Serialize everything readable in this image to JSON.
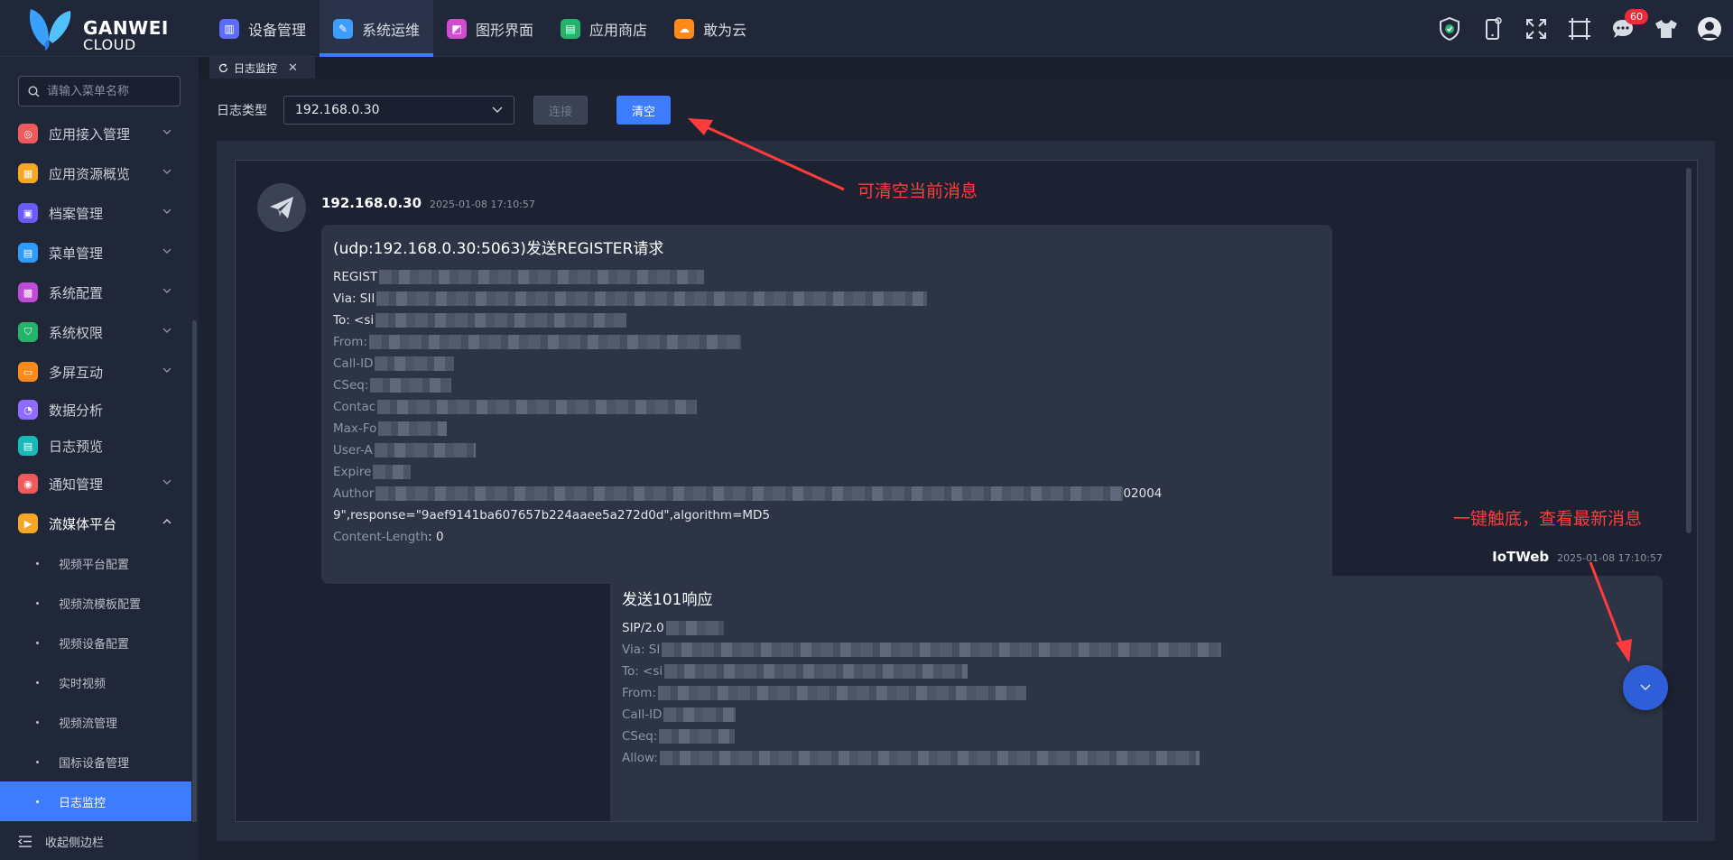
{
  "brand": {
    "line1": "GANWEI",
    "line2": "CLOUD"
  },
  "topnav": [
    {
      "label": "设备管理",
      "color": "#5b6cff"
    },
    {
      "label": "系统运维",
      "color": "#3d9cff"
    },
    {
      "label": "图形界面",
      "color": "#d14bd1"
    },
    {
      "label": "应用商店",
      "color": "#24b36b"
    },
    {
      "label": "敢为云",
      "color": "#ff8a1a"
    }
  ],
  "notifications": {
    "count": "60"
  },
  "search": {
    "placeholder": "请输入菜单名称"
  },
  "sidebar": {
    "items": [
      {
        "label": "应用接入管理",
        "color": "#ef5a5a"
      },
      {
        "label": "应用资源概览",
        "color": "#f5a623"
      },
      {
        "label": "档案管理",
        "color": "#6b5bff"
      },
      {
        "label": "菜单管理",
        "color": "#2f9bff"
      },
      {
        "label": "系统配置",
        "color": "#c14bd6"
      },
      {
        "label": "系统权限",
        "color": "#24b36b"
      },
      {
        "label": "多屏互动",
        "color": "#ff8a1a"
      },
      {
        "label": "数据分析",
        "color": "#8f6bff"
      },
      {
        "label": "日志预览",
        "color": "#19b9b9"
      },
      {
        "label": "通知管理",
        "color": "#ef5a5a"
      },
      {
        "label": "流媒体平台",
        "color": "#f5a623"
      }
    ],
    "subitems": [
      "视频平台配置",
      "视频流模板配置",
      "视频设备配置",
      "实时视频",
      "视频流管理",
      "国标设备管理",
      "日志监控"
    ],
    "collapse_label": "收起侧边栏"
  },
  "tab": {
    "label": "日志监控"
  },
  "toolbar": {
    "type_label": "日志类型",
    "selected": "192.168.0.30",
    "connect_label": "连接",
    "clear_label": "清空"
  },
  "messages": [
    {
      "sender": "192.168.0.30",
      "time": "2025-01-08 17:10:57",
      "title": "(udp:192.168.0.30:5063)发送REGISTER请求",
      "lines": [
        "REGIST",
        "Via: SII",
        "To: <si",
        "From:",
        "Call-ID",
        "CSeq:",
        "Contac",
        "Max-Fo",
        "User-A",
        "Expire",
        "Author"
      ],
      "tail1": "02004",
      "tail2": "9\",response=\"9aef9141ba607657b224aaee5a272d0d\",algorithm=MD5",
      "tail3_key": "Content-Length",
      "tail3_val": ": 0"
    },
    {
      "sender": "IoTWeb",
      "time": "2025-01-08 17:10:57",
      "title": "发送101响应",
      "lines": [
        "SIP/2.0",
        "Via: SI",
        "To: <si",
        "From:",
        "Call-ID",
        "CSeq:",
        "Allow:"
      ]
    }
  ],
  "annotations": {
    "clear_note": "可清空当前消息",
    "bottom_note": "一键触底，查看最新消息"
  }
}
